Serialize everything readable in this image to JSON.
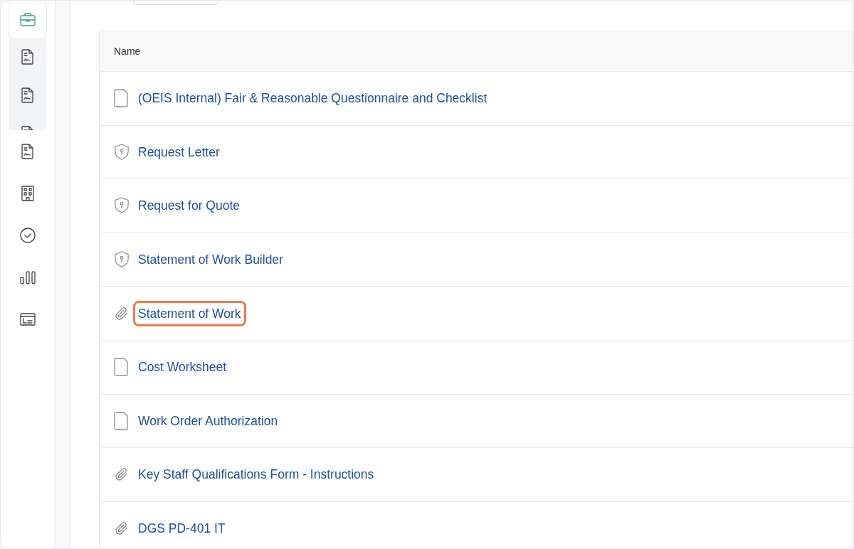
{
  "sidebar": {
    "items": [
      {
        "kind": "briefcase",
        "selected": true
      },
      {
        "kind": "signed-doc",
        "selected": false,
        "nested": true
      },
      {
        "kind": "signed-doc",
        "selected": false,
        "nested": true
      },
      {
        "kind": "signed-doc",
        "selected": false,
        "nested": true
      },
      {
        "kind": "signed-doc",
        "selected": false
      },
      {
        "kind": "building",
        "selected": false
      },
      {
        "kind": "check-circle",
        "selected": false
      },
      {
        "kind": "bars",
        "selected": false
      },
      {
        "kind": "card",
        "selected": false
      }
    ]
  },
  "table": {
    "columns": [
      "Name"
    ],
    "rows": [
      {
        "kind": "file",
        "name": "(OEIS Internal) Fair & Reasonable Questionnaire and Checklist",
        "highlighted": false
      },
      {
        "kind": "shield",
        "name": "Request Letter",
        "highlighted": false
      },
      {
        "kind": "shield",
        "name": "Request for Quote",
        "highlighted": false
      },
      {
        "kind": "shield",
        "name": "Statement of Work Builder",
        "highlighted": false
      },
      {
        "kind": "clip",
        "name": "Statement of Work",
        "highlighted": true
      },
      {
        "kind": "file",
        "name": "Cost Worksheet",
        "highlighted": false
      },
      {
        "kind": "file",
        "name": "Work Order Authorization",
        "highlighted": false
      },
      {
        "kind": "clip",
        "name": "Key Staff Qualifications Form - Instructions",
        "highlighted": false
      },
      {
        "kind": "clip",
        "name": "DGS PD-401 IT",
        "highlighted": false
      }
    ]
  }
}
